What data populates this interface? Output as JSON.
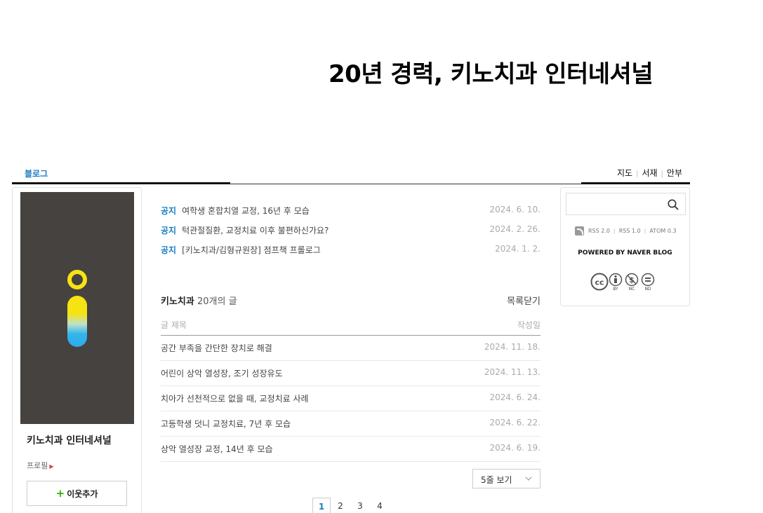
{
  "header": {
    "blog_title": "20년 경력, 키노치과 인터네셔널"
  },
  "nav": {
    "blog_tab": "블로그",
    "links": [
      "지도",
      "서재",
      "안부"
    ]
  },
  "profile": {
    "name": "키노치과 인터네셔널",
    "profile_link": "프로필",
    "add_neighbor": "이웃추가"
  },
  "notices": [
    {
      "tag": "공지",
      "title": "여학생 혼합치열 교정, 16년 후 모습",
      "date": "2024. 6. 10."
    },
    {
      "tag": "공지",
      "title": "턱관절질환, 교정치료 이후 불편하신가요?",
      "date": "2024. 2. 26."
    },
    {
      "tag": "공지",
      "title": "[키노치과/김형규원장] 점프책 프롤로그",
      "date": "2024. 1. 2."
    }
  ],
  "post_list": {
    "category": "키노치과",
    "count": "20개의 글",
    "close_label": "목록닫기",
    "col_title": "글 제목",
    "col_date": "작성일",
    "rows": [
      {
        "title": "공간 부족을 간단한 장치로 해결",
        "date": "2024. 11. 18."
      },
      {
        "title": "어린이 상악 열성장, 조기 성장유도",
        "date": "2024. 11. 13."
      },
      {
        "title": "치아가 선천적으로 없을 때, 교정치료 사례",
        "date": "2024. 6. 24."
      },
      {
        "title": "고등학생 덧니 교정치료, 7년 후 모습",
        "date": "2024. 6. 22."
      },
      {
        "title": "상악 열성장 교정, 14년 후 모습",
        "date": "2024. 6. 19."
      }
    ],
    "rows_select": "5줄 보기",
    "pages": [
      "1",
      "2",
      "3",
      "4"
    ]
  },
  "sidebar": {
    "search_placeholder": "",
    "feeds": [
      "RSS 2.0",
      "RSS 1.0",
      "ATOM 0.3"
    ],
    "powered_by": "POWERED BY NAVER BLOG",
    "cc_labels": [
      "BY",
      "NC",
      "ND"
    ]
  },
  "colors": {
    "accent": "#1a7dc0",
    "profile_bg": "#454240",
    "logo_yellow": "#f6e312",
    "logo_blue": "#2eaee9"
  }
}
